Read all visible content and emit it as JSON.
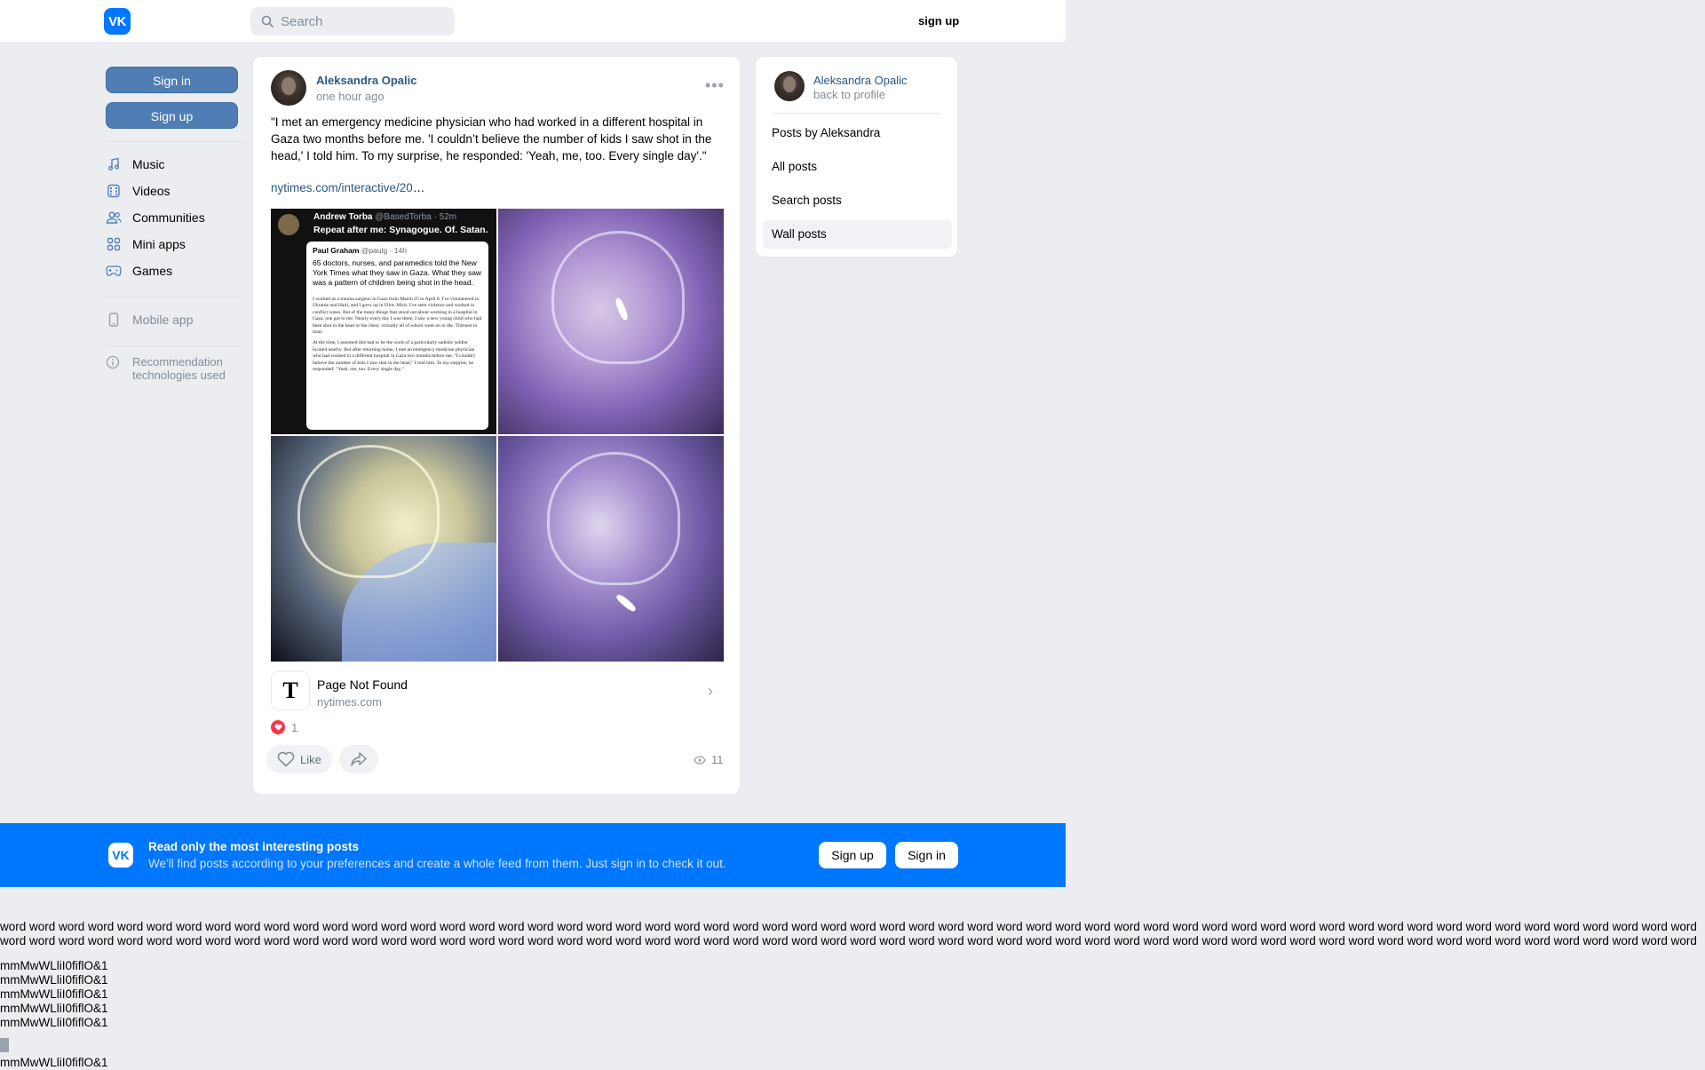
{
  "header": {
    "logo": "VK",
    "search_placeholder": "Search",
    "signup_link": "sign up"
  },
  "left_nav": {
    "sign_in": "Sign in",
    "sign_up": "Sign up",
    "items": [
      {
        "label": "Music",
        "icon": "music-note-icon"
      },
      {
        "label": "Videos",
        "icon": "video-icon"
      },
      {
        "label": "Communities",
        "icon": "users-icon"
      },
      {
        "label": "Mini apps",
        "icon": "apps-grid-icon"
      },
      {
        "label": "Games",
        "icon": "gamepad-icon"
      }
    ],
    "mobile_app": "Mobile app",
    "recommendation": "Recommendation technologies used"
  },
  "post": {
    "author": "Aleksandra Opalic",
    "time": "one hour ago",
    "text": "\"I met an emergency medicine physician who had worked in a different hospital in Gaza two months before me. 'I couldn’t believe the number of kids I saw shot in the head,' I told him. To my surprise, he responded: 'Yeah, me, too. Every single day'.\"",
    "link": "nytimes.com/interactive/20",
    "link_ellipsis": "…",
    "tweet": {
      "name": "Andrew Torba",
      "handle": "@BasedTorba · 52m",
      "title": "Repeat after me: Synagogue. Of. Satan.",
      "quoted_name": "Paul Graham",
      "quoted_handle": "@paulg · 14h",
      "quoted_text": "65 doctors, nurses, and paramedics told the New York Times what they saw in Gaza. What they saw was a pattern of children being shot in the head.",
      "article_p1": "I worked as a trauma surgeon in Gaza from March 25 to April 8. I've volunteered in Ukraine and Haiti, and I grew up in Flint, Mich. I've seen violence and worked in conflict zones. But of the many things that stood out about working in a hospital in Gaza, one got to me: Nearly every day I was there, I saw a new young child who had been shot in the head or the chest, virtually all of whom went on to die. Thirteen in total.",
      "article_p2": "At the time, I assumed this had to be the work of a particularly sadistic soldier located nearby. But after returning home, I met an emergency medicine physician who had worked in a different hospital in Gaza two months before me. \"I couldn't believe the number of kids I saw shot in the head,\" I told him. To my surprise, he responded: \"Yeah, me, too. Every single day.\""
    },
    "attachment": {
      "icon": "T",
      "title": "Page Not Found",
      "domain": "nytimes.com"
    },
    "reactions_count": "1",
    "like_label": "Like",
    "views": "11"
  },
  "right_card": {
    "name": "Aleksandra Opalic",
    "back": "back to profile",
    "items": [
      "Posts by Aleksandra",
      "All posts",
      "Search posts",
      "Wall posts"
    ],
    "active_index": 3
  },
  "banner": {
    "title": "Read only the most interesting posts",
    "subtitle": "We'll find posts according to your preferences and create a whole feed from them. Just sign in to check it out.",
    "sign_up": "Sign up",
    "sign_in": "Sign in"
  },
  "filler": {
    "words": "word word word word word word word word word word word word word word word word word word word word word word word word word word word word word word word word word word word word word word word word word word word word word word word word word word word word word word word word word word word word word word word word word word word word word word word word word word word word word word word word word word word word word word word word word word word word word word word word word word word word word word word word word word word word word word word word word word word word word word word word word word word word word word word word word word word word word word word",
    "glyph_lines": [
      "mmMwWLliI0fiflO&1",
      "mmMwWLliI0fiflO&1",
      "mmMwWLliI0fiflO&1",
      "mmMwWLliI0fiflO&1",
      "mmMwWLliI0fiflO&1"
    ],
    "glyph_last": "mmMwWLliI0fiflO&1"
  }
}
